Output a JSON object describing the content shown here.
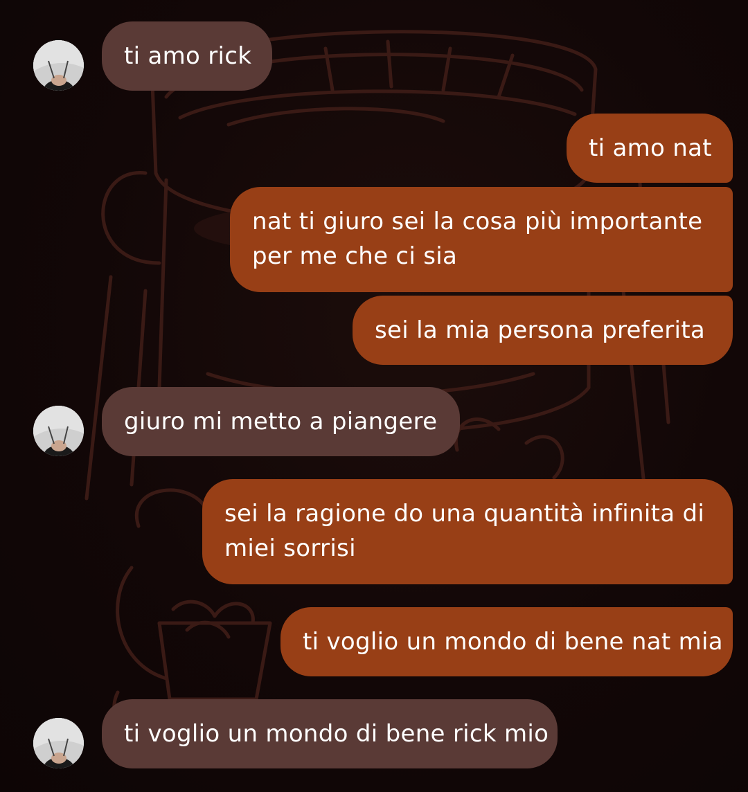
{
  "conversation": {
    "messages": [
      {
        "direction": "incoming",
        "text": "ti amo rick",
        "avatar": "contact-avatar"
      },
      {
        "direction": "outgoing",
        "text": "ti amo nat"
      },
      {
        "direction": "outgoing",
        "text": "nat ti giuro sei la cosa più importante\nper me che ci sia"
      },
      {
        "direction": "outgoing",
        "text": "sei la mia persona preferita"
      },
      {
        "direction": "incoming",
        "text": "giuro mi metto a piangere",
        "avatar": "contact-avatar"
      },
      {
        "direction": "outgoing",
        "text": "sei la ragione do una quantità infinita di\nmiei sorrisi"
      },
      {
        "direction": "outgoing",
        "text": "ti voglio un mondo di bene nat mia"
      },
      {
        "direction": "incoming",
        "text": "ti voglio un mondo di bene rick mio",
        "avatar": "contact-avatar"
      }
    ]
  },
  "theme": {
    "background": "#100606",
    "incoming_bubble": "#5a3a36",
    "outgoing_bubble": "#983f16",
    "wallpaper_line": "#3a1a15",
    "text": "#ffffff"
  }
}
